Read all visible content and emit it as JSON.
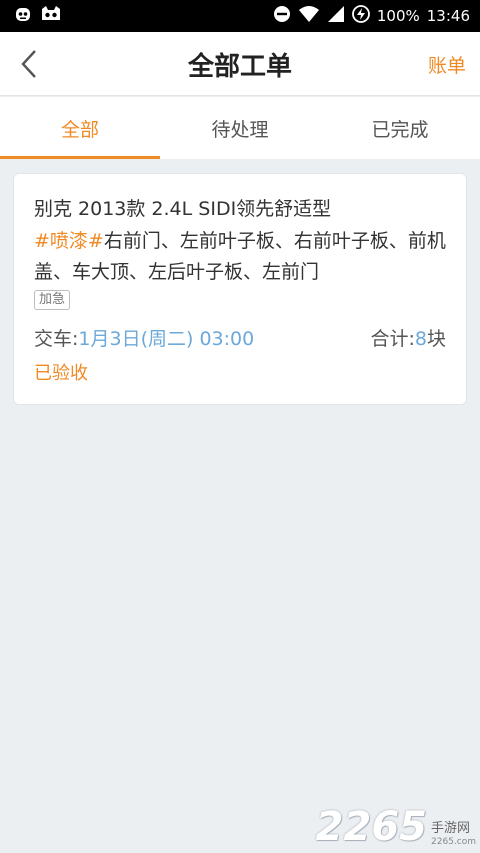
{
  "status_bar": {
    "battery": "100%",
    "time": "13:46",
    "icons": [
      "app-mascot-icon",
      "app-cat-icon",
      "do-not-disturb-icon",
      "wifi-icon",
      "signal-icon",
      "battery-charging-icon"
    ]
  },
  "header": {
    "title": "全部工单",
    "right_action": "账单",
    "back_icon": "chevron-left-icon"
  },
  "tabs": [
    {
      "label": "全部",
      "active": true
    },
    {
      "label": "待处理",
      "active": false
    },
    {
      "label": "已完成",
      "active": false
    }
  ],
  "orders": [
    {
      "car_model": "别克 2013款 2.4L SIDI领先舒适型",
      "tag": "#喷漆#",
      "items": "右前门、左前叶子板、右前叶子板、前机盖、车大顶、左后叶子板、左前门",
      "badge": "加急",
      "delivery_label": "交车:",
      "delivery_time": "1月3日(周二) 03:00",
      "total_label": "合计:",
      "total_count": "8",
      "total_unit": "块",
      "status": "已验收"
    }
  ],
  "watermark": {
    "number": "2265",
    "text": "手游网",
    "url": "2265.com"
  },
  "colors": {
    "accent": "#F08A24",
    "link_blue": "#6CA9DA",
    "background": "#ECEFF2"
  }
}
